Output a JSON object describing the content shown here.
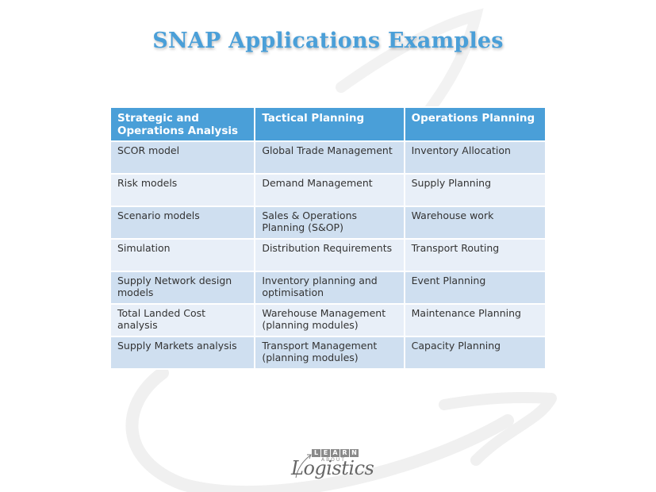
{
  "slide": {
    "title": "SNAP Applications Examples"
  },
  "table": {
    "headers": [
      "Strategic and Operations Analysis",
      "Tactical Planning",
      "Operations Planning"
    ],
    "rows": [
      [
        "SCOR model",
        "Global Trade Management",
        "Inventory Allocation"
      ],
      [
        "Risk models",
        "Demand Management",
        "Supply Planning"
      ],
      [
        "Scenario models",
        "Sales & Operations Planning (S&OP)",
        "Warehouse work"
      ],
      [
        "Simulation",
        "Distribution Requirements",
        "Transport Routing"
      ],
      [
        "Supply Network design models",
        "Inventory planning and optimisation",
        "Event Planning"
      ],
      [
        "Total Landed Cost analysis",
        "Warehouse Management (planning modules)",
        "Maintenance Planning"
      ],
      [
        "Supply Markets analysis",
        "Transport Management (planning modules)",
        "Capacity Planning"
      ]
    ]
  },
  "logo": {
    "learn_letters": [
      "L",
      "E",
      "A",
      "R",
      "N"
    ],
    "about": "ABOUT",
    "logistics": "Logistics"
  },
  "colors": {
    "accent": "#4a9fd8",
    "row_odd": "#cfdff0",
    "row_even": "#e8eff8",
    "swoosh": "#f0f0f0"
  }
}
